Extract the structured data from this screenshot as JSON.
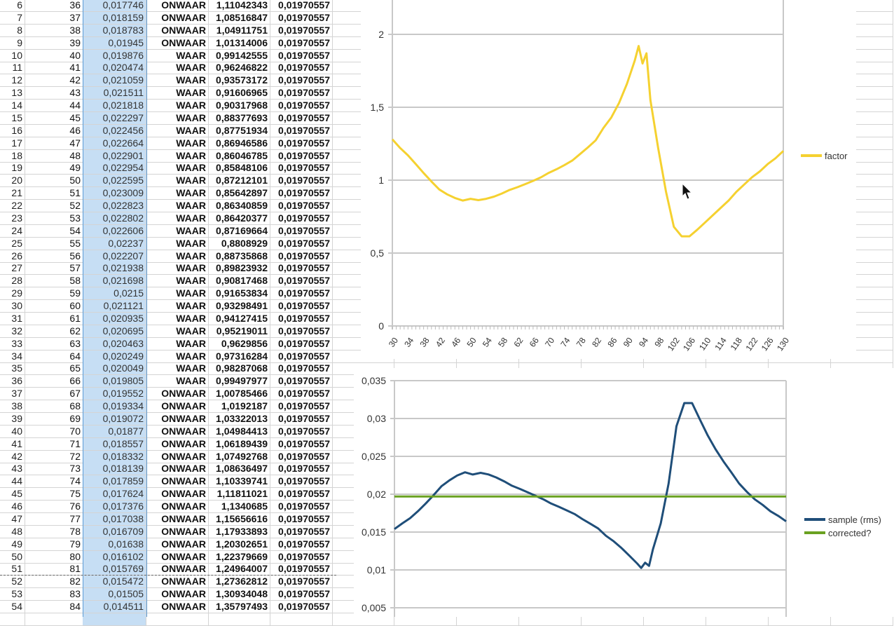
{
  "sheet": {
    "selected_column": "C",
    "rows": [
      [
        "6",
        "36",
        "0,017746",
        "ONWAAR",
        "1,11042343",
        "0,01970557"
      ],
      [
        "7",
        "37",
        "0,018159",
        "ONWAAR",
        "1,08516847",
        "0,01970557"
      ],
      [
        "8",
        "38",
        "0,018783",
        "ONWAAR",
        "1,04911751",
        "0,01970557"
      ],
      [
        "9",
        "39",
        "0,01945",
        "ONWAAR",
        "1,01314006",
        "0,01970557"
      ],
      [
        "10",
        "40",
        "0,019876",
        "WAAR",
        "0,99142555",
        "0,01970557"
      ],
      [
        "11",
        "41",
        "0,020474",
        "WAAR",
        "0,96246822",
        "0,01970557"
      ],
      [
        "12",
        "42",
        "0,021059",
        "WAAR",
        "0,93573172",
        "0,01970557"
      ],
      [
        "13",
        "43",
        "0,021511",
        "WAAR",
        "0,91606965",
        "0,01970557"
      ],
      [
        "14",
        "44",
        "0,021818",
        "WAAR",
        "0,90317968",
        "0,01970557"
      ],
      [
        "15",
        "45",
        "0,022297",
        "WAAR",
        "0,88377693",
        "0,01970557"
      ],
      [
        "16",
        "46",
        "0,022456",
        "WAAR",
        "0,87751934",
        "0,01970557"
      ],
      [
        "17",
        "47",
        "0,022664",
        "WAAR",
        "0,86946586",
        "0,01970557"
      ],
      [
        "18",
        "48",
        "0,022901",
        "WAAR",
        "0,86046785",
        "0,01970557"
      ],
      [
        "19",
        "49",
        "0,022954",
        "WAAR",
        "0,85848106",
        "0,01970557"
      ],
      [
        "20",
        "50",
        "0,022595",
        "WAAR",
        "0,87212101",
        "0,01970557"
      ],
      [
        "21",
        "51",
        "0,023009",
        "WAAR",
        "0,85642897",
        "0,01970557"
      ],
      [
        "22",
        "52",
        "0,022823",
        "WAAR",
        "0,86340859",
        "0,01970557"
      ],
      [
        "23",
        "53",
        "0,022802",
        "WAAR",
        "0,86420377",
        "0,01970557"
      ],
      [
        "24",
        "54",
        "0,022606",
        "WAAR",
        "0,87169664",
        "0,01970557"
      ],
      [
        "25",
        "55",
        "0,02237",
        "WAAR",
        "0,8808929",
        "0,01970557"
      ],
      [
        "26",
        "56",
        "0,022207",
        "WAAR",
        "0,88735868",
        "0,01970557"
      ],
      [
        "27",
        "57",
        "0,021938",
        "WAAR",
        "0,89823932",
        "0,01970557"
      ],
      [
        "28",
        "58",
        "0,021698",
        "WAAR",
        "0,90817468",
        "0,01970557"
      ],
      [
        "29",
        "59",
        "0,0215",
        "WAAR",
        "0,91653834",
        "0,01970557"
      ],
      [
        "30",
        "60",
        "0,021121",
        "WAAR",
        "0,93298491",
        "0,01970557"
      ],
      [
        "31",
        "61",
        "0,020935",
        "WAAR",
        "0,94127415",
        "0,01970557"
      ],
      [
        "32",
        "62",
        "0,020695",
        "WAAR",
        "0,95219011",
        "0,01970557"
      ],
      [
        "33",
        "63",
        "0,020463",
        "WAAR",
        "0,9629856",
        "0,01970557"
      ],
      [
        "34",
        "64",
        "0,020249",
        "WAAR",
        "0,97316284",
        "0,01970557"
      ],
      [
        "35",
        "65",
        "0,020049",
        "WAAR",
        "0,98287068",
        "0,01970557"
      ],
      [
        "36",
        "66",
        "0,019805",
        "WAAR",
        "0,99497977",
        "0,01970557"
      ],
      [
        "37",
        "67",
        "0,019552",
        "ONWAAR",
        "1,00785466",
        "0,01970557"
      ],
      [
        "38",
        "68",
        "0,019334",
        "ONWAAR",
        "1,0192187",
        "0,01970557"
      ],
      [
        "39",
        "69",
        "0,019072",
        "ONWAAR",
        "1,03322013",
        "0,01970557"
      ],
      [
        "40",
        "70",
        "0,01877",
        "ONWAAR",
        "1,04984413",
        "0,01970557"
      ],
      [
        "41",
        "71",
        "0,018557",
        "ONWAAR",
        "1,06189439",
        "0,01970557"
      ],
      [
        "42",
        "72",
        "0,018332",
        "ONWAAR",
        "1,07492768",
        "0,01970557"
      ],
      [
        "43",
        "73",
        "0,018139",
        "ONWAAR",
        "1,08636497",
        "0,01970557"
      ],
      [
        "44",
        "74",
        "0,017859",
        "ONWAAR",
        "1,10339741",
        "0,01970557"
      ],
      [
        "45",
        "75",
        "0,017624",
        "ONWAAR",
        "1,11811021",
        "0,01970557"
      ],
      [
        "46",
        "76",
        "0,017376",
        "ONWAAR",
        "1,1340685",
        "0,01970557"
      ],
      [
        "47",
        "77",
        "0,017038",
        "ONWAAR",
        "1,15656616",
        "0,01970557"
      ],
      [
        "48",
        "78",
        "0,016709",
        "ONWAAR",
        "1,17933893",
        "0,01970557"
      ],
      [
        "49",
        "79",
        "0,01638",
        "ONWAAR",
        "1,20302651",
        "0,01970557"
      ],
      [
        "50",
        "80",
        "0,016102",
        "ONWAAR",
        "1,22379669",
        "0,01970557"
      ],
      [
        "51",
        "81",
        "0,015769",
        "ONWAAR",
        "1,24964007",
        "0,01970557"
      ],
      [
        "52",
        "82",
        "0,015472",
        "ONWAAR",
        "1,27362812",
        "0,01970557"
      ],
      [
        "53",
        "83",
        "0,01505",
        "ONWAAR",
        "1,30934048",
        "0,01970557"
      ],
      [
        "54",
        "84",
        "0,014511",
        "ONWAAR",
        "1,35797493",
        "0,01970557"
      ]
    ]
  },
  "chart_data": [
    {
      "type": "line",
      "title": "",
      "xlabel": "",
      "ylabel": "",
      "xlim": [
        30,
        130
      ],
      "ylim": [
        0,
        2
      ],
      "y_ticks": [
        "0",
        "0,5",
        "1",
        "1,5",
        "2"
      ],
      "y_tick_values": [
        0,
        0.5,
        1,
        1.5,
        2
      ],
      "x_tick_labels": [
        "30",
        "34",
        "38",
        "42",
        "46",
        "50",
        "54",
        "58",
        "62",
        "66",
        "70",
        "74",
        "78",
        "82",
        "86",
        "90",
        "94",
        "98",
        "102",
        "106",
        "110",
        "114",
        "118",
        "122",
        "126",
        "130"
      ],
      "grid": true,
      "legend_position": "right",
      "x": [
        30,
        32,
        34,
        36,
        38,
        40,
        42,
        44,
        46,
        48,
        50,
        52,
        54,
        56,
        58,
        60,
        62,
        64,
        66,
        68,
        70,
        72,
        74,
        76,
        78,
        80,
        82,
        84,
        86,
        88,
        90,
        92,
        93,
        94,
        95,
        96,
        98,
        100,
        102,
        104,
        106,
        108,
        110,
        112,
        114,
        116,
        118,
        120,
        122,
        124,
        126,
        128,
        130
      ],
      "series": [
        {
          "name": "factor",
          "color": "#f5d130",
          "values": [
            1.28,
            1.22,
            1.17,
            1.11,
            1.049,
            0.991,
            0.936,
            0.903,
            0.878,
            0.86,
            0.872,
            0.863,
            0.872,
            0.887,
            0.908,
            0.933,
            0.952,
            0.973,
            0.995,
            1.019,
            1.05,
            1.075,
            1.103,
            1.134,
            1.179,
            1.224,
            1.273,
            1.358,
            1.43,
            1.53,
            1.66,
            1.82,
            1.92,
            1.8,
            1.87,
            1.55,
            1.22,
            0.92,
            0.68,
            0.615,
            0.615,
            0.66,
            0.71,
            0.76,
            0.81,
            0.86,
            0.92,
            0.97,
            1.02,
            1.06,
            1.11,
            1.15,
            1.2
          ]
        }
      ]
    },
    {
      "type": "line",
      "title": "",
      "xlabel": "",
      "ylabel": "",
      "xlim": [
        30,
        130
      ],
      "ylim": [
        0.005,
        0.035
      ],
      "y_ticks": [
        "0,005",
        "0,01",
        "0,015",
        "0,02",
        "0,025",
        "0,03",
        "0,035"
      ],
      "y_tick_values": [
        0.005,
        0.01,
        0.015,
        0.02,
        0.025,
        0.03,
        0.035
      ],
      "grid": true,
      "legend_position": "right",
      "x": [
        30,
        32,
        34,
        36,
        38,
        40,
        42,
        44,
        46,
        48,
        50,
        52,
        54,
        56,
        58,
        60,
        62,
        64,
        66,
        68,
        70,
        72,
        74,
        76,
        78,
        80,
        82,
        84,
        86,
        88,
        90,
        92,
        93,
        94,
        95,
        96,
        98,
        100,
        102,
        104,
        106,
        108,
        110,
        112,
        114,
        116,
        118,
        120,
        122,
        124,
        126,
        128,
        130
      ],
      "series": [
        {
          "name": "sample (rms)",
          "color": "#1f4e79",
          "values": [
            0.0154,
            0.01615,
            0.01684,
            0.01775,
            0.01878,
            0.01988,
            0.02106,
            0.02182,
            0.02246,
            0.0229,
            0.0226,
            0.02282,
            0.02261,
            0.02221,
            0.0217,
            0.02112,
            0.0207,
            0.02025,
            0.01981,
            0.01933,
            0.01877,
            0.01833,
            0.01786,
            0.01738,
            0.01671,
            0.0161,
            0.01548,
            0.01451,
            0.01378,
            0.01288,
            0.01187,
            0.01083,
            0.01026,
            0.01095,
            0.01054,
            0.01271,
            0.01615,
            0.02142,
            0.02898,
            0.03204,
            0.03204,
            0.02986,
            0.02775,
            0.02593,
            0.02433,
            0.02291,
            0.02142,
            0.02031,
            0.01932,
            0.01859,
            0.01775,
            0.01714,
            0.01642
          ]
        },
        {
          "name": "corrected?",
          "color": "#6aa121",
          "values": [
            0.01970557,
            0.01970557
          ]
        }
      ]
    }
  ]
}
